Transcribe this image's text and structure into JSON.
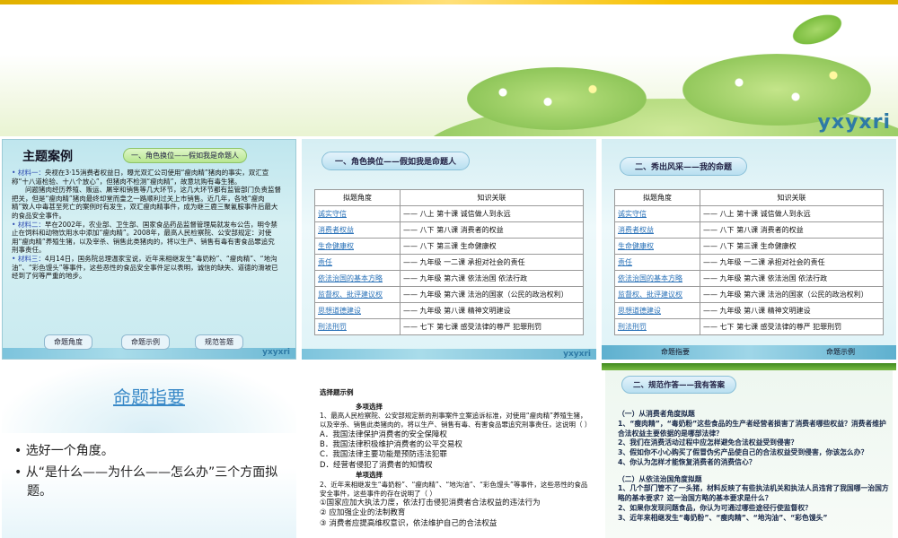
{
  "banner": {
    "logo": "yxyxri"
  },
  "slide1": {
    "title": "主题案例",
    "badge": "一、角色换位——假如我是命题人",
    "m1_label": "材料一：",
    "m1_text": "央视在3·15消费者权益日，曝光双汇公司使用“瘦肉精”猪肉的事实，双汇宣称“十八道检验、十八个放心”，但猪肉不检测“瘦肉精”，故意坑购有毒生猪。",
    "m1_cont": "问题猪肉经历养殖、贩运、屠宰和销售等几大环节，这几大环节都有监管部门负责监督把关，但是“瘦肉精”猪肉最终却堂而皇之一路顺利过关上市销售。近几年，各地“瘦肉精”致人中毒甚至死亡的案例时有发生，双汇瘦肉精事件，成为继三鹿三聚氰胺事件后最大的食品安全事件。",
    "m2_label": "材料二：",
    "m2_text": "早在2002年，农业部、卫生部、国家食品药品监督管理局就发布公告，明令禁止在饲料和动物饮用水中添加“瘦肉精”。2008年，最高人民检察院、公安部规定：对使用“瘦肉精”养殖生猪，以及宰杀、销售此类猪肉的，将以生产、销售有毒有害食品罪追究刑事责任。",
    "m3_label": "材料三：",
    "m3_text": "4月14日，国务院总理温家宝说，近年来相继发生“毒奶粉”、“瘦肉精”、“地沟油”、“彩色馒头”等事件，这些恶性的食品安全事件足以表明，诚信的缺失、道德的滑坡已经到了何等严重的地步。",
    "nav": [
      "命题角度",
      "命题示例",
      "规范答题"
    ],
    "logo": "yxyxri"
  },
  "slide2": {
    "title": "一、角色换位——假如我是命题人",
    "col1": "拟题角度",
    "col2": "知识关联",
    "rows": [
      {
        "angle": "诚实守信",
        "know": "—— 八上    第十课   诚信做人到永远"
      },
      {
        "angle": "消费者权益",
        "know": "—— 八下    第八课   消费者的权益"
      },
      {
        "angle": "生命健康权",
        "know": "—— 八下    第三课   生命健康权"
      },
      {
        "angle": "责任",
        "know": "—— 九年级   一二课   承担对社会的责任"
      },
      {
        "angle": "依法治国的基本方略",
        "know": "—— 九年级   第六课   依法治国  依法行政"
      },
      {
        "angle": "监督权、批评建议权",
        "know": "—— 九年级   第六课   法治的国家（公民的政治权利）"
      },
      {
        "angle": "思想道德建设",
        "know": "—— 九年级   第八课   精神文明建设"
      },
      {
        "angle": "刑法刑罚",
        "know": "—— 七下    第七课   感受法律的尊严  犯罪刑罚"
      }
    ],
    "logo": "yxyxri"
  },
  "slide3": {
    "title": "二、秀出风采——我的命题",
    "col1": "拟题角度",
    "col2": "知识关联",
    "rows": [
      {
        "angle": "诚实守信",
        "know": "—— 八上    第十课   诚信做人到永远"
      },
      {
        "angle": "消费者权益",
        "know": "—— 八下    第八课   消费者的权益"
      },
      {
        "angle": "生命健康权",
        "know": "—— 八下    第三课   生命健康权"
      },
      {
        "angle": "责任",
        "know": "—— 九年级   一二课   承担对社会的责任"
      },
      {
        "angle": "依法治国的基本方略",
        "know": "—— 九年级   第六课   依法治国  依法行政"
      },
      {
        "angle": "监督权、批评建议权",
        "know": "—— 九年级   第六课   法治的国家（公民的政治权利）"
      },
      {
        "angle": "思想道德建设",
        "know": "—— 九年级   第八课   精神文明建设"
      },
      {
        "angle": "刑法刑罚",
        "know": "—— 七下    第七课   感受法律的尊严  犯罪刑罚"
      }
    ],
    "nav": [
      "命题指要",
      "命题示例"
    ]
  },
  "slide4": {
    "title": "命题指要",
    "b1": "选好一个角度。",
    "b2": "从“是什么——为什么——怎么办”三个方面拟题。"
  },
  "slide5": {
    "title": "选择题示例",
    "sec1": "多项选择",
    "q1": "1、最高人民检察院、公安部规定新的刑事案件立案追诉标准，对使用“瘦肉精”养殖生猪，以及宰杀、销售此类猪肉的，将以生产、销售有毒、有害食品罪追究刑事责任，这说明（    ）",
    "optA": "A．我国法律保护消费者的安全保障权",
    "optB": "B．我国法律积极维护消费者的公平交易权",
    "optC": "C．我国法律主要功能是预防违法犯罪",
    "optD": "D．经营者侵犯了消费者的知情权",
    "sec2": "单项选择",
    "q2": "2、近年来相继发生“毒奶粉”、“瘦肉精”、“地沟油”、“彩色馒头”等事件，这些恶性的食品安全事件，这些事件的存在说明了（    ）",
    "o1": "①国家应加大执法力度，依法打击侵犯消费者合法权益的违法行为",
    "o2": "② 应加强企业的法制教育",
    "o3": "③ 消费者应提高维权意识，依法维护自己的合法权益"
  },
  "slide6": {
    "title": "二、规范作答——我有答案",
    "h1": "（一）从消费者角度拟题",
    "p1": "1、“瘦肉精”，“毒奶粉”这些食品的生产者经营者损害了消费者哪些权益？消费者维护合法权益主要依据的是哪部法律？",
    "p2": "2、我们在消费活动过程中应怎样避免合法权益受到侵害？",
    "p3": "3、假如你不小心购买了假冒伪劣产品使自己的合法权益受到侵害，你该怎么办？",
    "p4": "4、你认为怎样才能恢复消费者的消费信心？",
    "h2": "（二）从依法治国角度拟题",
    "p5": "1、几个部门管不了一头猪，材料反映了有些执法机关和执法人员违背了我国哪一治国方略的基本要求？这一治国方略的基本要求是什么？",
    "p6": "2、如果你发现问题食品，你认为可通过哪些途径行使监督权？",
    "p7": "3、近年来相继发生“毒奶粉”、“瘦肉精”、“地沟油”、“彩色馒头”"
  }
}
